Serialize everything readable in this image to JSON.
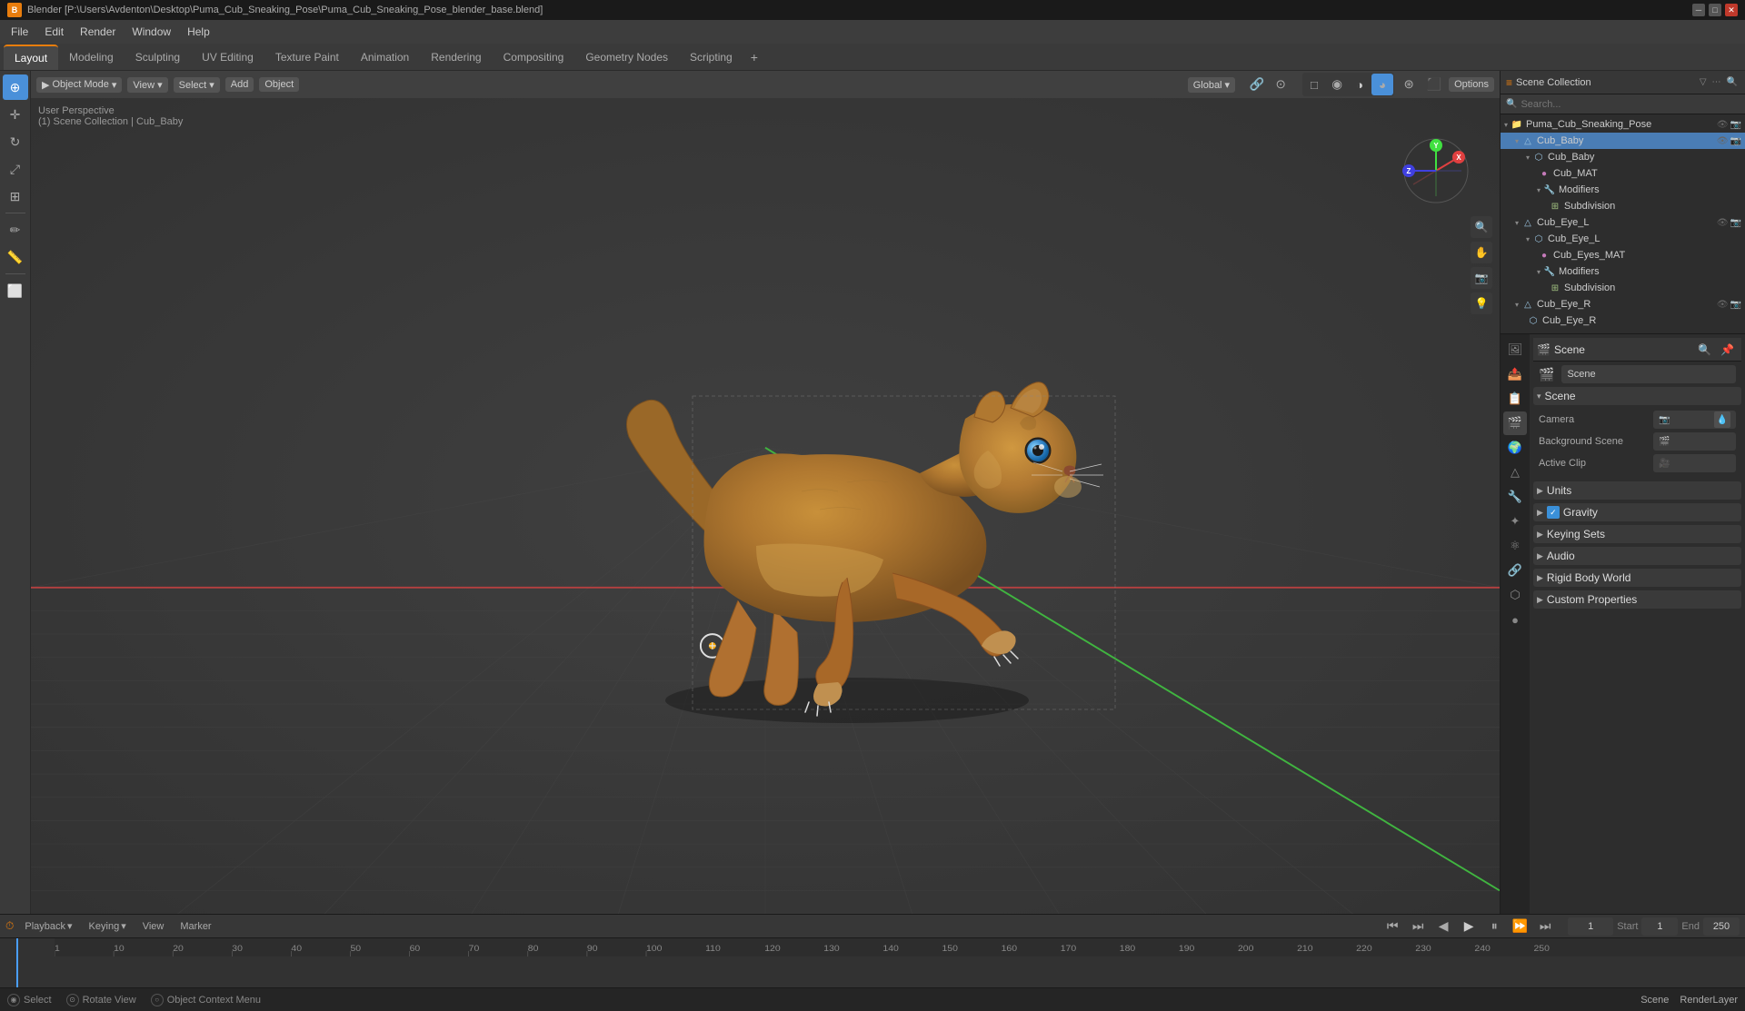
{
  "window": {
    "title": "Blender [P:\\Users\\Avdenton\\Desktop\\Puma_Cub_Sneaking_Pose\\Puma_Cub_Sneaking_Pose_blender_base.blend]",
    "icon": "B"
  },
  "menu": {
    "items": [
      "File",
      "Edit",
      "Render",
      "Window",
      "Help"
    ]
  },
  "workspace_tabs": {
    "tabs": [
      "Layout",
      "Modeling",
      "Sculpting",
      "UV Editing",
      "Texture Paint",
      "Animation",
      "Rendering",
      "Compositing",
      "Geometry Nodes",
      "Scripting"
    ],
    "active": "Layout",
    "add_label": "+"
  },
  "viewport": {
    "mode": "Object Mode",
    "viewport_shading": "Global",
    "perspective": "User Perspective",
    "scene_info": "(1) Scene Collection | Cub_Baby",
    "options_label": "Options"
  },
  "outliner": {
    "title": "Scene Collection",
    "items": [
      {
        "label": "Puma_Cub_Sneaking_Pose",
        "indent": 0,
        "type": "collection",
        "expanded": true
      },
      {
        "label": "Cub_Baby",
        "indent": 1,
        "type": "object",
        "expanded": true,
        "selected": true
      },
      {
        "label": "Cub_Baby",
        "indent": 2,
        "type": "mesh"
      },
      {
        "label": "Cub_MAT",
        "indent": 3,
        "type": "material"
      },
      {
        "label": "Modifiers",
        "indent": 3,
        "type": "modifier",
        "expanded": true
      },
      {
        "label": "Subdivision",
        "indent": 4,
        "type": "subdivision"
      },
      {
        "label": "Cub_Eye_L",
        "indent": 1,
        "type": "object",
        "expanded": true
      },
      {
        "label": "Cub_Eye_L",
        "indent": 2,
        "type": "mesh"
      },
      {
        "label": "Cub_Eyes_MAT",
        "indent": 3,
        "type": "material"
      },
      {
        "label": "Modifiers",
        "indent": 3,
        "type": "modifier",
        "expanded": true
      },
      {
        "label": "Subdivision",
        "indent": 4,
        "type": "subdivision"
      },
      {
        "label": "Cub_Eye_R",
        "indent": 1,
        "type": "object",
        "expanded": true
      },
      {
        "label": "Cub_Eye_R",
        "indent": 2,
        "type": "mesh"
      }
    ]
  },
  "properties": {
    "scene_label": "Scene",
    "scene_section": {
      "label": "Scene",
      "camera_label": "Camera",
      "background_scene_label": "Background Scene",
      "active_clip_label": "Active Clip"
    },
    "units_label": "Units",
    "gravity_label": "Gravity",
    "gravity_checked": true,
    "keying_sets_label": "Keying Sets",
    "audio_label": "Audio",
    "rigid_body_world_label": "Rigid Body World",
    "custom_properties_label": "Custom Properties"
  },
  "timeline": {
    "playback_label": "Playback",
    "keying_label": "Keying",
    "view_label": "View",
    "marker_label": "Marker",
    "frame_current": "1",
    "frame_start_label": "Start",
    "frame_start": "1",
    "frame_end_label": "End",
    "frame_end": "250",
    "ruler_marks": [
      "1",
      "10",
      "20",
      "30",
      "40",
      "50",
      "60",
      "70",
      "80",
      "90",
      "100",
      "110",
      "120",
      "130",
      "140",
      "150",
      "160",
      "170",
      "180",
      "190",
      "200",
      "210",
      "220",
      "230",
      "240",
      "250"
    ]
  },
  "status_bar": {
    "select_label": "Select",
    "rotate_label": "Rotate View",
    "context_menu_label": "Object Context Menu"
  },
  "scene_name": "Scene",
  "render_layer": "RenderLayer"
}
